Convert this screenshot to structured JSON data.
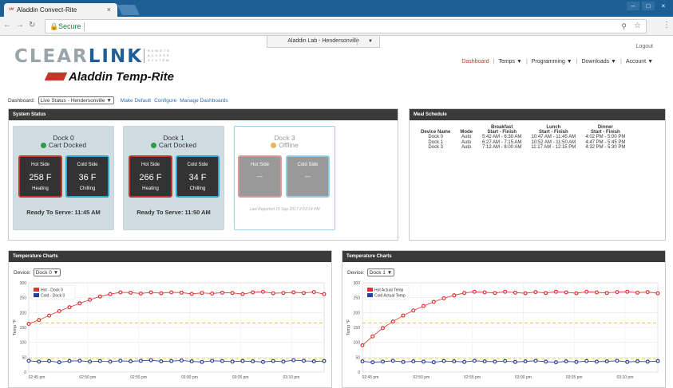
{
  "browser": {
    "tab_title": "Aladdin Convect-Rite",
    "tab_close": "×",
    "url_secure_label": "Secure",
    "window_buttons": [
      "–",
      "□",
      "×"
    ]
  },
  "header": {
    "logo_text_a": "CLEAR",
    "logo_text_b": "LINK",
    "logo_tagline": "REMOTE ACCESS SYSTEM",
    "logo_brand": "Aladdin Temp-Rite",
    "lab_selector": "Aladdin Lab - Hendersonville",
    "lab_selector_caret": "▼",
    "logout": "Logout",
    "nav": [
      {
        "label": "Dashboard"
      },
      {
        "label": "Temps ▼"
      },
      {
        "label": "Programming ▼"
      },
      {
        "label": "Downloads ▼"
      },
      {
        "label": "Account ▼"
      }
    ]
  },
  "dashbar": {
    "label": "Dashboard:",
    "selected": "Live Status - Hendersonville ▼",
    "make_default": "Make Default",
    "configure": "Configure",
    "manage": "Manage Dashboards"
  },
  "system_status": {
    "title": "System Status",
    "docks": [
      {
        "name": "Dock 0",
        "status": "Cart Docked",
        "hot_label": "Hot Side",
        "hot_value": "258 F",
        "hot_state": "Heating",
        "cold_label": "Cold Side",
        "cold_value": "36 F",
        "cold_state": "Chilling",
        "footer": "Ready To Serve: 11:45 AM"
      },
      {
        "name": "Dock 1",
        "status": "Cart Docked",
        "hot_label": "Hot Side",
        "hot_value": "266 F",
        "hot_state": "Heating",
        "cold_label": "Cold Side",
        "cold_value": "34 F",
        "cold_state": "Chilling",
        "footer": "Ready To Serve: 11:50 AM"
      },
      {
        "name": "Dock 3",
        "status": "Offline",
        "hot_label": "Hot Side",
        "hot_value": "---",
        "cold_label": "Cold Side",
        "cold_value": "---",
        "footer": "Last Reported 15 Sep 2017 2:03:14 PM"
      }
    ]
  },
  "meal_schedule": {
    "title": "Meal Schedule",
    "headers": [
      "Device Name",
      "Mode",
      "Breakfast",
      "Lunch",
      "Dinner"
    ],
    "subheader": "Start - Finish",
    "rows": [
      [
        "Dock 0",
        "Auto",
        "5:42 AM - 6:30 AM",
        "10:47 AM - 11:45 AM",
        "4:02 PM - 5:00 PM"
      ],
      [
        "Dock 1",
        "Auto",
        "6:27 AM - 7:15 AM",
        "10:52 AM - 11:50 AM",
        "4:47 PM - 5:45 PM"
      ],
      [
        "Dock 3",
        "Auto",
        "7:12 AM - 8:00 AM",
        "11:17 AM - 12:15 PM",
        "4:32 PM - 5:30 PM"
      ]
    ]
  },
  "temp_panels": [
    {
      "title": "Temperature Charts",
      "device_label": "Device:",
      "device_value": "Dock 0 ▼"
    },
    {
      "title": "Temperature Charts",
      "device_label": "Device:",
      "device_value": "Dock 1 ▼"
    }
  ],
  "colors": {
    "hot": "#e03030",
    "cold": "#2b3f9e",
    "threshold": "#f0d060",
    "accent_red": "#c0392b",
    "link": "#2b6cb0"
  },
  "chart_data": [
    {
      "type": "line",
      "ylabel": "Temp °F",
      "ylim": [
        0,
        300
      ],
      "yticks": [
        0,
        50,
        100,
        150,
        200,
        250,
        300
      ],
      "xticks": [
        "02:45 pm",
        "02:50 pm",
        "02:55 pm",
        "03:00 pm",
        "03:05 pm",
        "03:10 pm"
      ],
      "xlim": [
        0,
        29
      ],
      "legend_position": "top-left",
      "threshold_lines": [
        165,
        45
      ],
      "series": [
        {
          "name": "Hot - Dock 0",
          "color": "#e03030",
          "x": [
            0,
            1,
            2,
            3,
            4,
            5,
            6,
            7,
            8,
            9,
            10,
            11,
            12,
            13,
            14,
            15,
            16,
            17,
            18,
            19,
            20,
            21,
            22,
            23,
            24,
            25,
            26,
            27,
            28,
            29
          ],
          "values": [
            162,
            175,
            190,
            205,
            218,
            231,
            243,
            254,
            262,
            268,
            267,
            264,
            268,
            265,
            268,
            267,
            263,
            266,
            264,
            267,
            266,
            262,
            268,
            270,
            265,
            266,
            268,
            266,
            269,
            262
          ]
        },
        {
          "name": "Cold - Dock 0",
          "color": "#2b3f9e",
          "x": [
            0,
            1,
            2,
            3,
            4,
            5,
            6,
            7,
            8,
            9,
            10,
            11,
            12,
            13,
            14,
            15,
            16,
            17,
            18,
            19,
            20,
            21,
            22,
            23,
            24,
            25,
            26,
            27,
            28,
            29
          ],
          "values": [
            38,
            35,
            37,
            33,
            37,
            38,
            35,
            37,
            35,
            38,
            36,
            38,
            40,
            36,
            37,
            39,
            36,
            34,
            38,
            37,
            35,
            37,
            36,
            34,
            37,
            35,
            40,
            38,
            36,
            37
          ]
        }
      ]
    },
    {
      "type": "line",
      "ylabel": "Temp °F",
      "ylim": [
        0,
        300
      ],
      "yticks": [
        0,
        50,
        100,
        150,
        200,
        250,
        300
      ],
      "xticks": [
        "02:45 pm",
        "02:50 pm",
        "02:55 pm",
        "03:00 pm",
        "03:05 pm",
        "03:10 pm"
      ],
      "xlim": [
        0,
        29
      ],
      "legend_position": "top-left",
      "threshold_lines": [
        165,
        45
      ],
      "series": [
        {
          "name": "Hot Actual Temp",
          "color": "#e03030",
          "x": [
            0,
            1,
            2,
            3,
            4,
            5,
            6,
            7,
            8,
            9,
            10,
            11,
            12,
            13,
            14,
            15,
            16,
            17,
            18,
            19,
            20,
            21,
            22,
            23,
            24,
            25,
            26,
            27,
            28,
            29
          ],
          "values": [
            90,
            120,
            148,
            170,
            190,
            207,
            222,
            236,
            248,
            258,
            266,
            270,
            268,
            266,
            270,
            267,
            265,
            269,
            266,
            270,
            268,
            265,
            270,
            268,
            266,
            269,
            270,
            267,
            269,
            265
          ]
        },
        {
          "name": "Cold Actual Temp",
          "color": "#2b3f9e",
          "x": [
            0,
            1,
            2,
            3,
            4,
            5,
            6,
            7,
            8,
            9,
            10,
            11,
            12,
            13,
            14,
            15,
            16,
            17,
            18,
            19,
            20,
            21,
            22,
            23,
            24,
            25,
            26,
            27,
            28,
            29
          ],
          "values": [
            36,
            33,
            35,
            38,
            34,
            36,
            35,
            33,
            37,
            36,
            34,
            38,
            36,
            35,
            37,
            34,
            36,
            38,
            35,
            33,
            36,
            34,
            37,
            35,
            36,
            38,
            34,
            36,
            35,
            37
          ]
        }
      ]
    }
  ]
}
